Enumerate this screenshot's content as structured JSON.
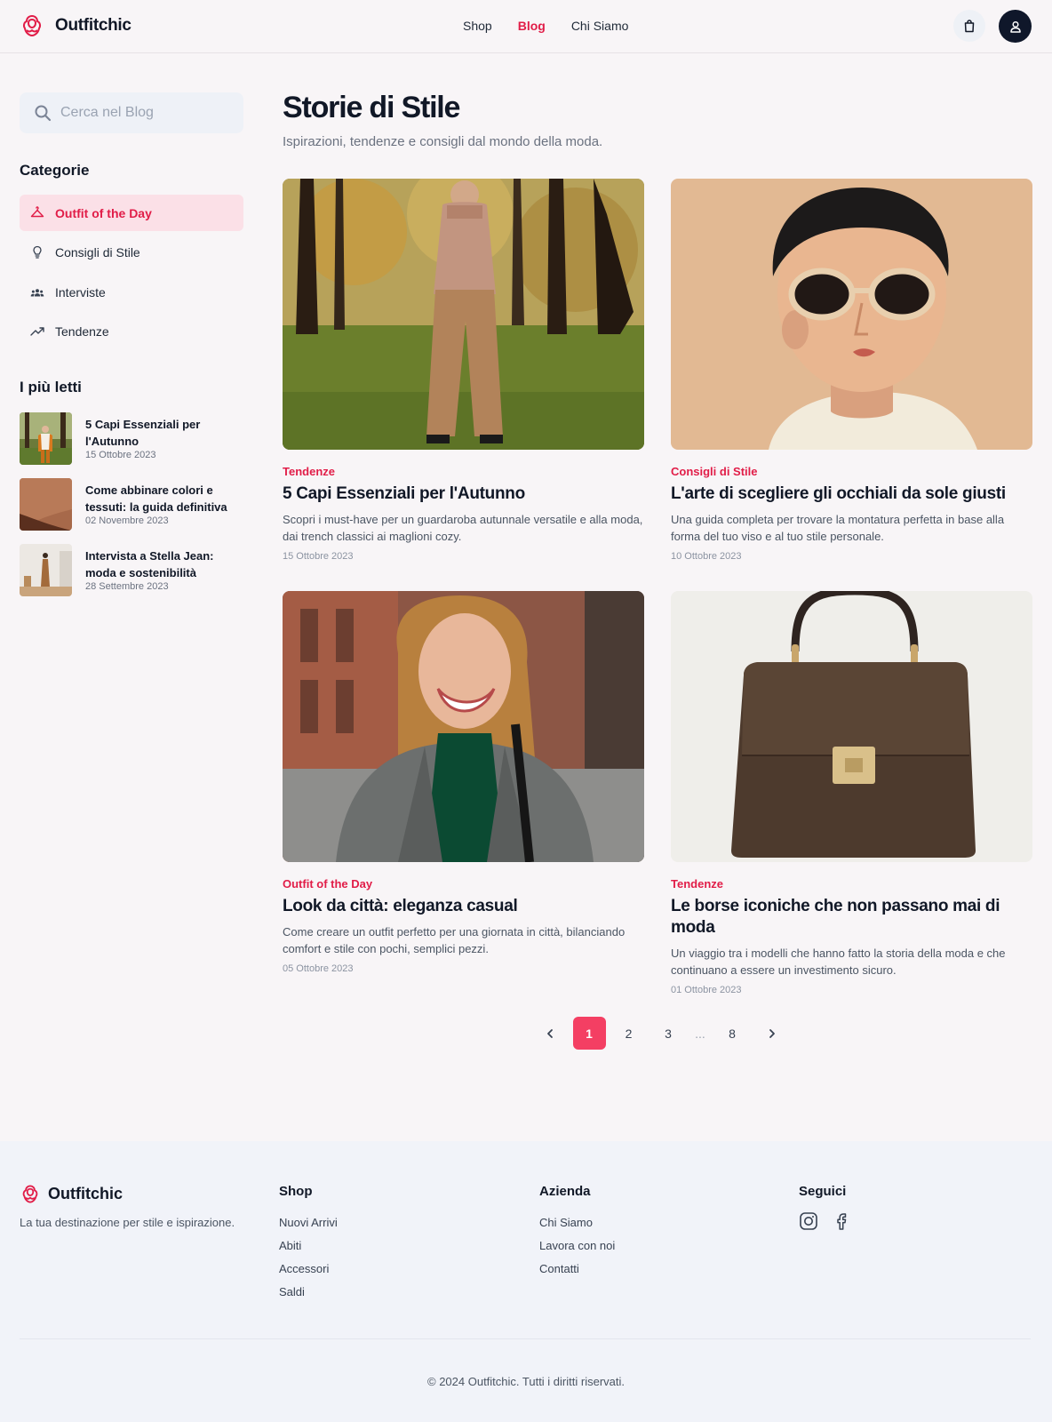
{
  "brand": {
    "name": "Outfitchic",
    "accent": "#e11d48"
  },
  "nav": {
    "items": [
      "Shop",
      "Blog",
      "Chi Siamo"
    ],
    "active": "Blog"
  },
  "header": {
    "cart_icon": "shopping-bag-icon",
    "user_icon": "user-icon"
  },
  "search": {
    "placeholder": "Cerca nel Blog",
    "value": ""
  },
  "sidebar": {
    "categories_title": "Categorie",
    "categories": [
      {
        "label": "Outfit of the Day",
        "icon": "hanger-icon",
        "active": true
      },
      {
        "label": "Consigli di Stile",
        "icon": "lightbulb-icon",
        "active": false
      },
      {
        "label": "Interviste",
        "icon": "users-icon",
        "active": false
      },
      {
        "label": "Tendenze",
        "icon": "trending-up-icon",
        "active": false
      }
    ],
    "popular_title": "I più letti",
    "popular": [
      {
        "title": "5 Capi Essenziali per l'Autunno",
        "date": "15 Ottobre 2023"
      },
      {
        "title": "Come abbinare colori e tessuti: la guida definitiva",
        "date": "02 Novembre 2023"
      },
      {
        "title": "Intervista a Stella Jean: moda e sostenibilità",
        "date": "28 Settembre 2023"
      }
    ]
  },
  "main": {
    "title": "Storie di Stile",
    "subtitle": "Ispirazioni, tendenze e consigli dal mondo della moda.",
    "posts": [
      {
        "category": "Tendenze",
        "title": "5 Capi Essenziali per l'Autunno",
        "desc": "Scopri i must-have per un guardaroba autunnale versatile e alla moda, dai trench classici ai maglioni cozy.",
        "date": "15 Ottobre 2023"
      },
      {
        "category": "Consigli di Stile",
        "title": "L'arte di scegliere gli occhiali da sole giusti",
        "desc": "Una guida completa per trovare la montatura perfetta in base alla forma del tuo viso e al tuo stile personale.",
        "date": "10 Ottobre 2023"
      },
      {
        "category": "Outfit of the Day",
        "title": "Look da città: eleganza casual",
        "desc": "Come creare un outfit perfetto per una giornata in città, bilanciando comfort e stile con pochi, semplici pezzi.",
        "date": "05 Ottobre 2023"
      },
      {
        "category": "Tendenze",
        "title": "Le borse iconiche che non passano mai di moda",
        "desc": "Un viaggio tra i modelli che hanno fatto la storia della moda e che continuano a essere un investimento sicuro.",
        "date": "01 Ottobre 2023"
      }
    ]
  },
  "pagination": {
    "pages": [
      "1",
      "2",
      "3",
      "8"
    ],
    "current": "1",
    "ellipsis": "..."
  },
  "footer": {
    "tagline": "La tua destinazione per stile e ispirazione.",
    "shop_title": "Shop",
    "shop_links": [
      "Nuovi Arrivi",
      "Abiti",
      "Accessori",
      "Saldi"
    ],
    "company_title": "Azienda",
    "company_links": [
      "Chi Siamo",
      "Lavora con noi",
      "Contatti"
    ],
    "social_title": "Seguici",
    "social_icons": [
      "instagram-icon",
      "facebook-icon"
    ],
    "copyright": "© 2024 Outfitchic. Tutti i diritti riservati."
  }
}
